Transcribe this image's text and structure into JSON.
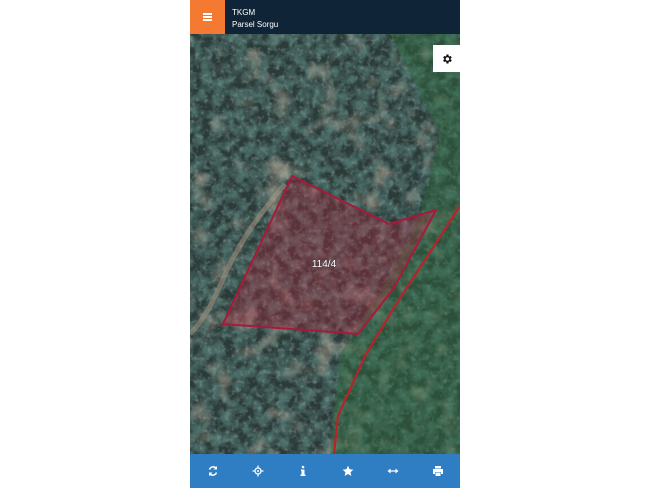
{
  "header": {
    "app_name": "TKGM",
    "subtitle": "Parsel Sorgu"
  },
  "map": {
    "parcel_label": "114/4",
    "parcel_color": "#c0223d",
    "road_color": "#b8232a"
  },
  "toolbar": {
    "icons": [
      "refresh-icon",
      "locate-icon",
      "info-icon",
      "star-icon",
      "measure-icon",
      "print-icon"
    ]
  },
  "colors": {
    "header_bg": "#0f2436",
    "menu_accent": "#f47a31",
    "toolbar_bg": "#2f7ec3"
  }
}
